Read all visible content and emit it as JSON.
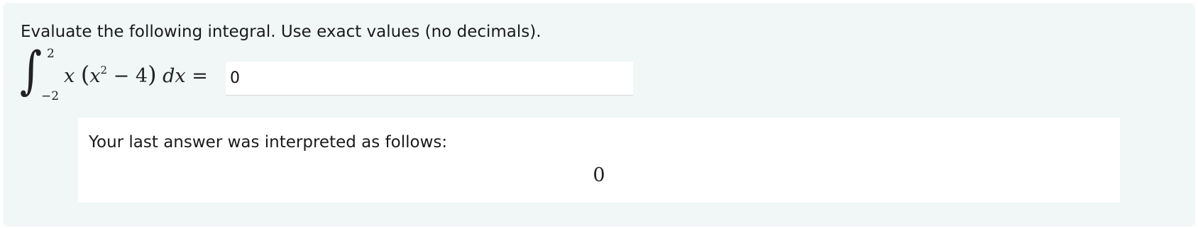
{
  "question": {
    "prompt": "Evaluate the following integral. Use exact values (no decimals).",
    "integral": {
      "sign": "∫",
      "upper_limit": "2",
      "lower_limit": "−2",
      "var_x": "x",
      "open_paren": "(",
      "inner_var": "x",
      "exponent": "2",
      "minus_four": " − 4",
      "close_paren": ")",
      "differential": "dx",
      "equals": "="
    },
    "answer_value": "0"
  },
  "feedback": {
    "label": "Your last answer was interpreted as follows:",
    "interpreted_value": "0"
  }
}
